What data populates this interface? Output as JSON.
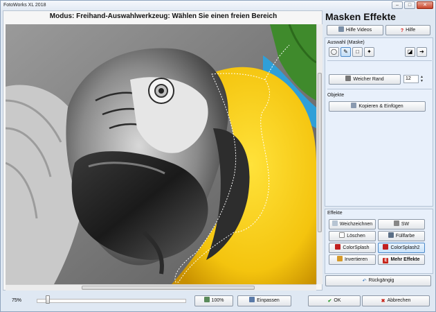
{
  "window": {
    "title": "FotoWorks XL 2018"
  },
  "mode_text": "Modus: Freihand-Auswahlwerkzeug: Wählen Sie einen freien Bereich",
  "panel": {
    "title": "Masken Effekte",
    "help_videos": "Hilfe Videos",
    "help": "Hilfe",
    "selection_label": "Auswahl (Maske)",
    "soft_edge": "Weicher Rand",
    "soft_edge_value": "12",
    "objects_label": "Objekte",
    "copy_paste": "Kopieren & Einfügen",
    "effects_label": "Effekte",
    "effects": [
      {
        "label": "Weichzeichnen",
        "icon": "blur-icon"
      },
      {
        "label": "SW",
        "icon": "bw-icon"
      },
      {
        "label": "Löschen",
        "icon": "eraser-icon"
      },
      {
        "label": "Füllfarbe",
        "icon": "fill-color-icon"
      },
      {
        "label": "ColorSplash",
        "icon": "colorsplash-icon"
      },
      {
        "label": "ColorSplash2",
        "icon": "colorsplash2-icon"
      },
      {
        "label": "Invertieren",
        "icon": "invert-icon"
      },
      {
        "label": "Mehr Effekte",
        "icon": "more-effects-icon"
      }
    ],
    "undo": "Rückgängig"
  },
  "bottom": {
    "zoom_percent": "75%",
    "zoom_slider_fraction": 0.06,
    "zoom100": "100%",
    "fit": "Einpassen",
    "ok": "OK",
    "cancel": "Abbrechen"
  },
  "colors": {
    "accent_blue": "#4a88c8",
    "parrot_yellow": "#f4c40e",
    "parrot_blue": "#2f9fd8",
    "leaf_green": "#3f8a2c",
    "ok_green": "#2e9b2e",
    "cancel_red": "#c8261c"
  }
}
